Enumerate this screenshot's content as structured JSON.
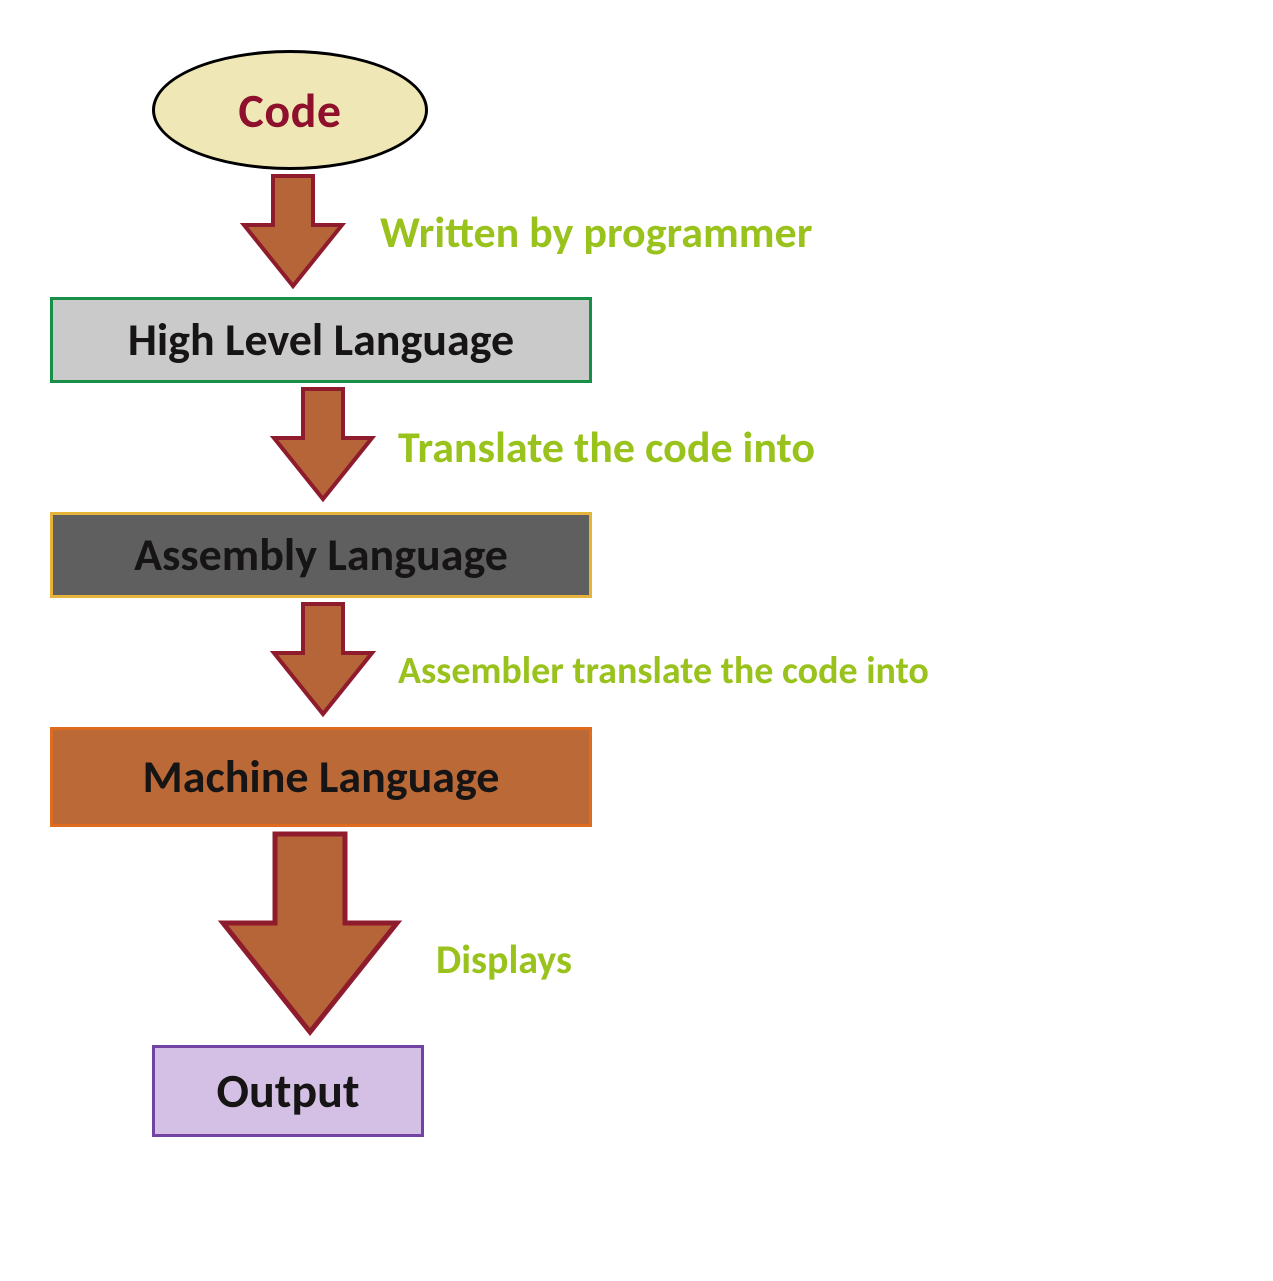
{
  "nodes": {
    "code": {
      "label": "Code"
    },
    "hll": {
      "label": "High Level Language"
    },
    "asm": {
      "label": "Assembly Language"
    },
    "mach": {
      "label": "Machine Language"
    },
    "output": {
      "label": "Output"
    }
  },
  "edges": {
    "e1": {
      "label": "Written by programmer"
    },
    "e2": {
      "label": "Translate the code into"
    },
    "e3": {
      "label": "Assembler translate the code into"
    },
    "e4": {
      "label": "Displays"
    }
  },
  "style": {
    "arrow_fill": "#b56538",
    "arrow_stroke": "#8e1c2c",
    "edge_label_color": "#99c21c"
  }
}
